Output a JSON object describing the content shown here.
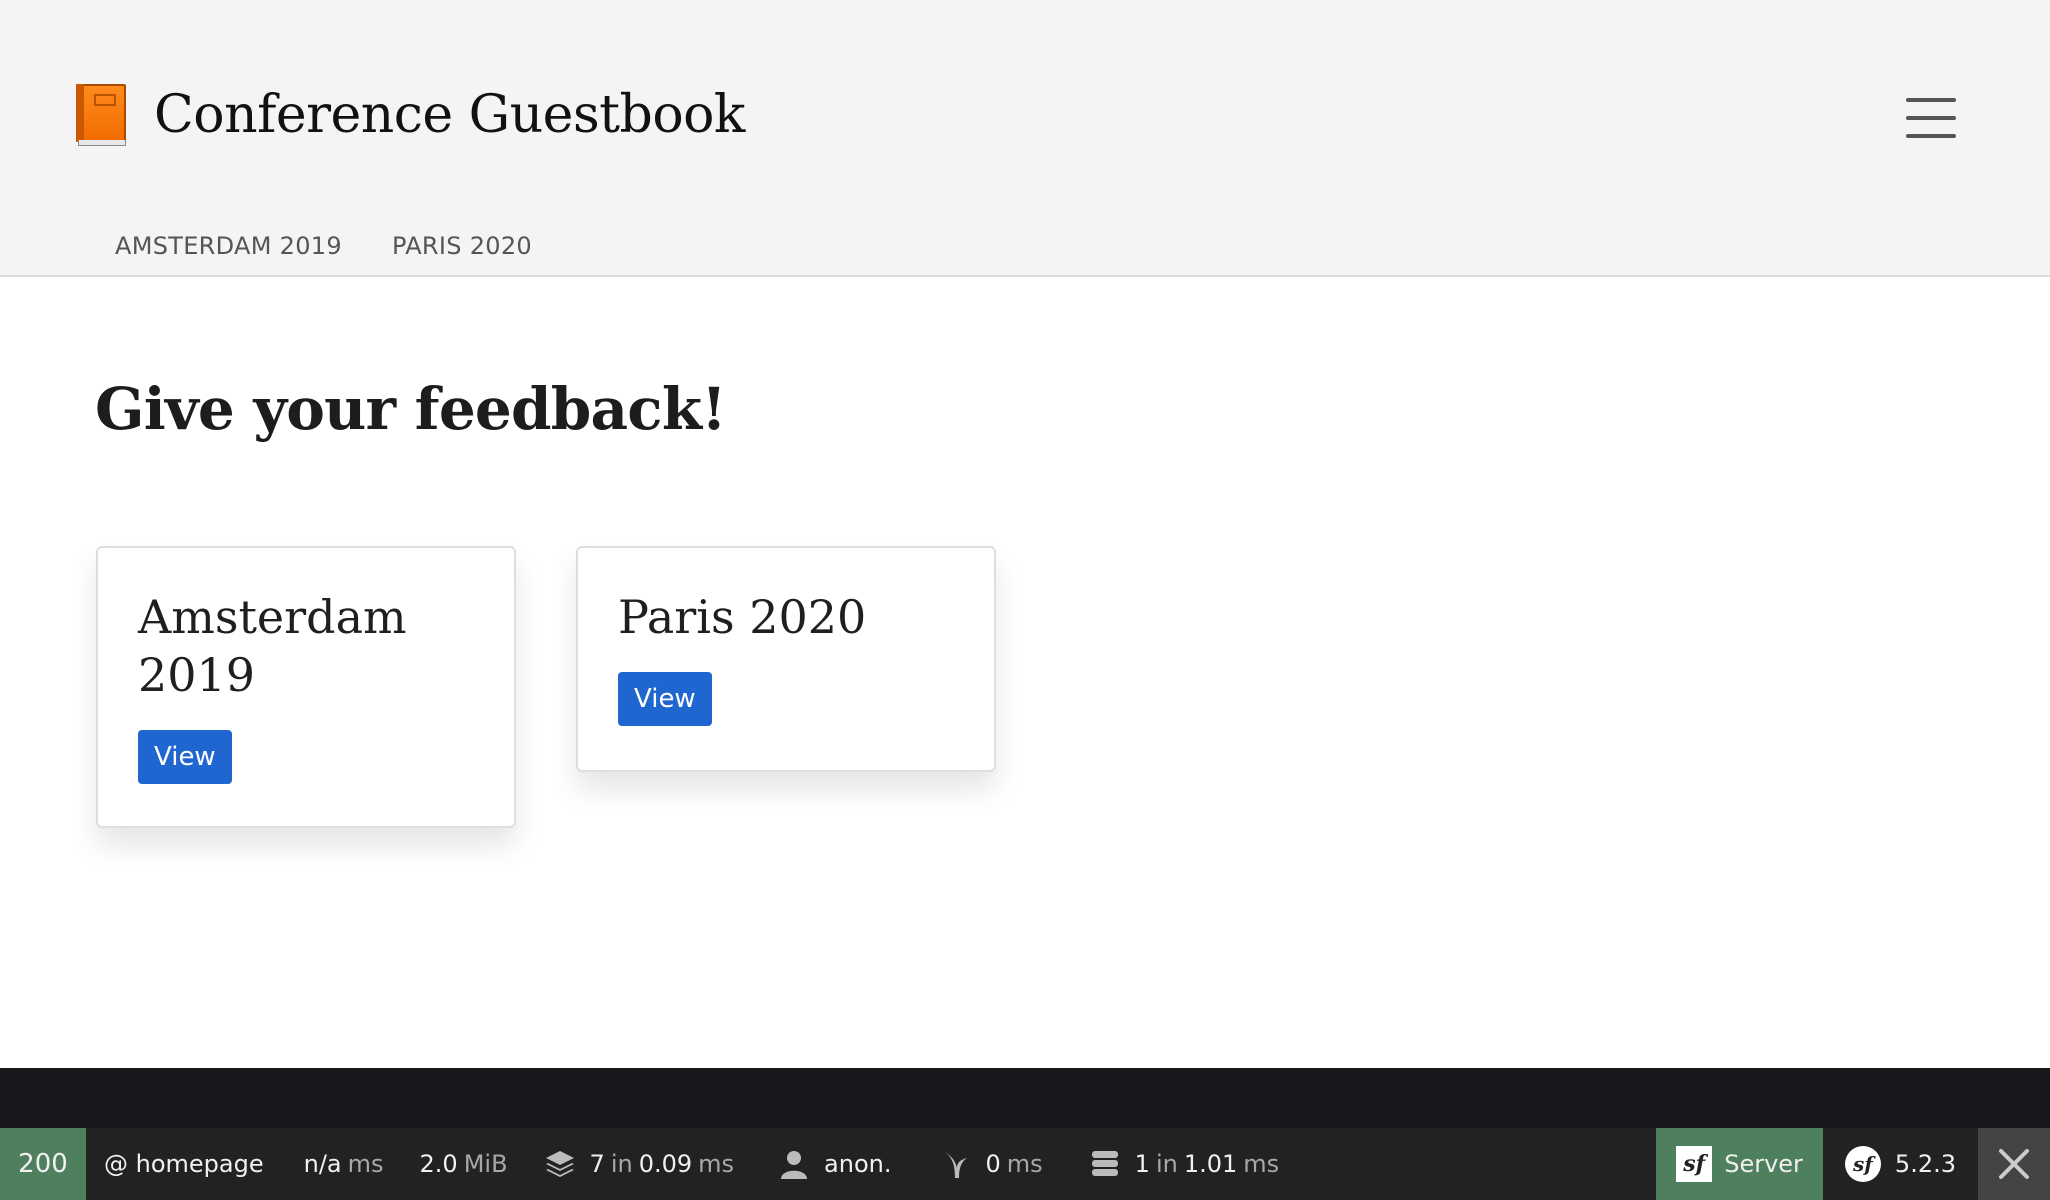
{
  "header": {
    "title": "Conference Guestbook",
    "nav": [
      {
        "label": "AMSTERDAM 2019"
      },
      {
        "label": "PARIS 2020"
      }
    ]
  },
  "main": {
    "heading": "Give your feedback!",
    "conferences": [
      {
        "title": "Amsterdam 2019",
        "button": "View"
      },
      {
        "title": "Paris 2020",
        "button": "View"
      }
    ]
  },
  "toolbar": {
    "status_code": "200",
    "route": "@ homepage",
    "time_value": "n/a",
    "time_unit": "ms",
    "memory_value": "2.0",
    "memory_unit": "MiB",
    "twig_count": "7",
    "twig_in": "in",
    "twig_time": "0.09",
    "twig_unit": "ms",
    "user": "anon.",
    "cache_time": "0",
    "cache_unit": "ms",
    "db_count": "1",
    "db_in": "in",
    "db_time": "1.01",
    "db_unit": "ms",
    "server_label": "Server",
    "version": "5.2.3",
    "colors": {
      "status_bg": "#4f805d",
      "toolbar_bg": "#222222",
      "button_bg": "#1f66d1"
    }
  }
}
